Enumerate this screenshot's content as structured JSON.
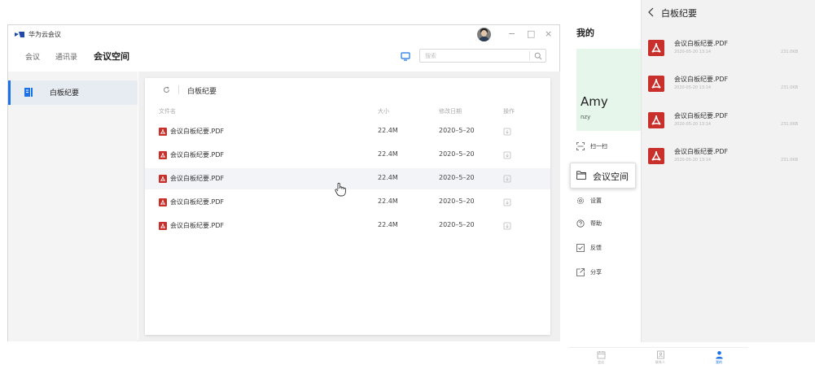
{
  "desktop": {
    "app_title": "华为云会议",
    "window_controls": {
      "minimize": "−",
      "maximize": "□",
      "close": "×"
    },
    "nav": {
      "tabs": [
        {
          "label": "会议",
          "active": false
        },
        {
          "label": "通讯录",
          "active": false
        },
        {
          "label": "会议空间",
          "active": true
        }
      ]
    },
    "search": {
      "placeholder": "搜索",
      "value": ""
    },
    "sidebar": {
      "items": [
        {
          "label": "白板纪要",
          "active": true,
          "icon": "document-icon"
        }
      ]
    },
    "main": {
      "breadcrumb": "白板纪要",
      "columns": {
        "name": "文件名",
        "size": "大小",
        "date": "修改日期",
        "action": "操作"
      },
      "rows": [
        {
          "name": "会议白板纪要.PDF",
          "size": "22.4M",
          "date": "2020–5–20"
        },
        {
          "name": "会议白板纪要.PDF",
          "size": "22.4M",
          "date": "2020–5–20"
        },
        {
          "name": "会议白板纪要.PDF",
          "size": "22.4M",
          "date": "2020–5–20"
        },
        {
          "name": "会议白板纪要.PDF",
          "size": "22.4M",
          "date": "2020–5–20"
        },
        {
          "name": "会议白板纪要.PDF",
          "size": "22.4M",
          "date": "2020–5–20"
        }
      ],
      "hover_row": 2
    }
  },
  "mobile_me": {
    "title": "我的",
    "profile": {
      "name": "Amy",
      "id": "nzy"
    },
    "menu": [
      {
        "label": "扫一扫",
        "icon": "scan-icon"
      },
      {
        "label": "会议空间",
        "icon": "folder-icon",
        "highlighted": true
      },
      {
        "label": "设置",
        "icon": "gear-icon"
      },
      {
        "label": "帮助",
        "icon": "help-icon"
      },
      {
        "label": "反馈",
        "icon": "feedback-icon"
      },
      {
        "label": "分享",
        "icon": "share-icon"
      }
    ],
    "tabbar": [
      {
        "label": "会议",
        "icon": "calendar-icon",
        "active": false
      },
      {
        "label": "联系人",
        "icon": "contacts-icon",
        "active": false
      },
      {
        "label": "我的",
        "icon": "person-icon",
        "active": true
      }
    ]
  },
  "mobile_list": {
    "title": "白板纪要",
    "items": [
      {
        "name": "会议白板纪要.PDF",
        "date": "2020-05-20  13:14",
        "size": "231.0KB"
      },
      {
        "name": "会议白板纪要.PDF",
        "date": "2020-05-20  13:14",
        "size": "231.0KB"
      },
      {
        "name": "会议白板纪要.PDF",
        "date": "2020-05-20  13:14",
        "size": "231.0KB"
      },
      {
        "name": "会议白板纪要.PDF",
        "date": "2020-05-20  13:14",
        "size": "231.0KB"
      }
    ]
  },
  "colors": {
    "accent": "#1a73e8",
    "pdf_red": "#c9302c",
    "profile_bg": "#e6f6ea",
    "brand_blue": "#1f4aa8"
  }
}
